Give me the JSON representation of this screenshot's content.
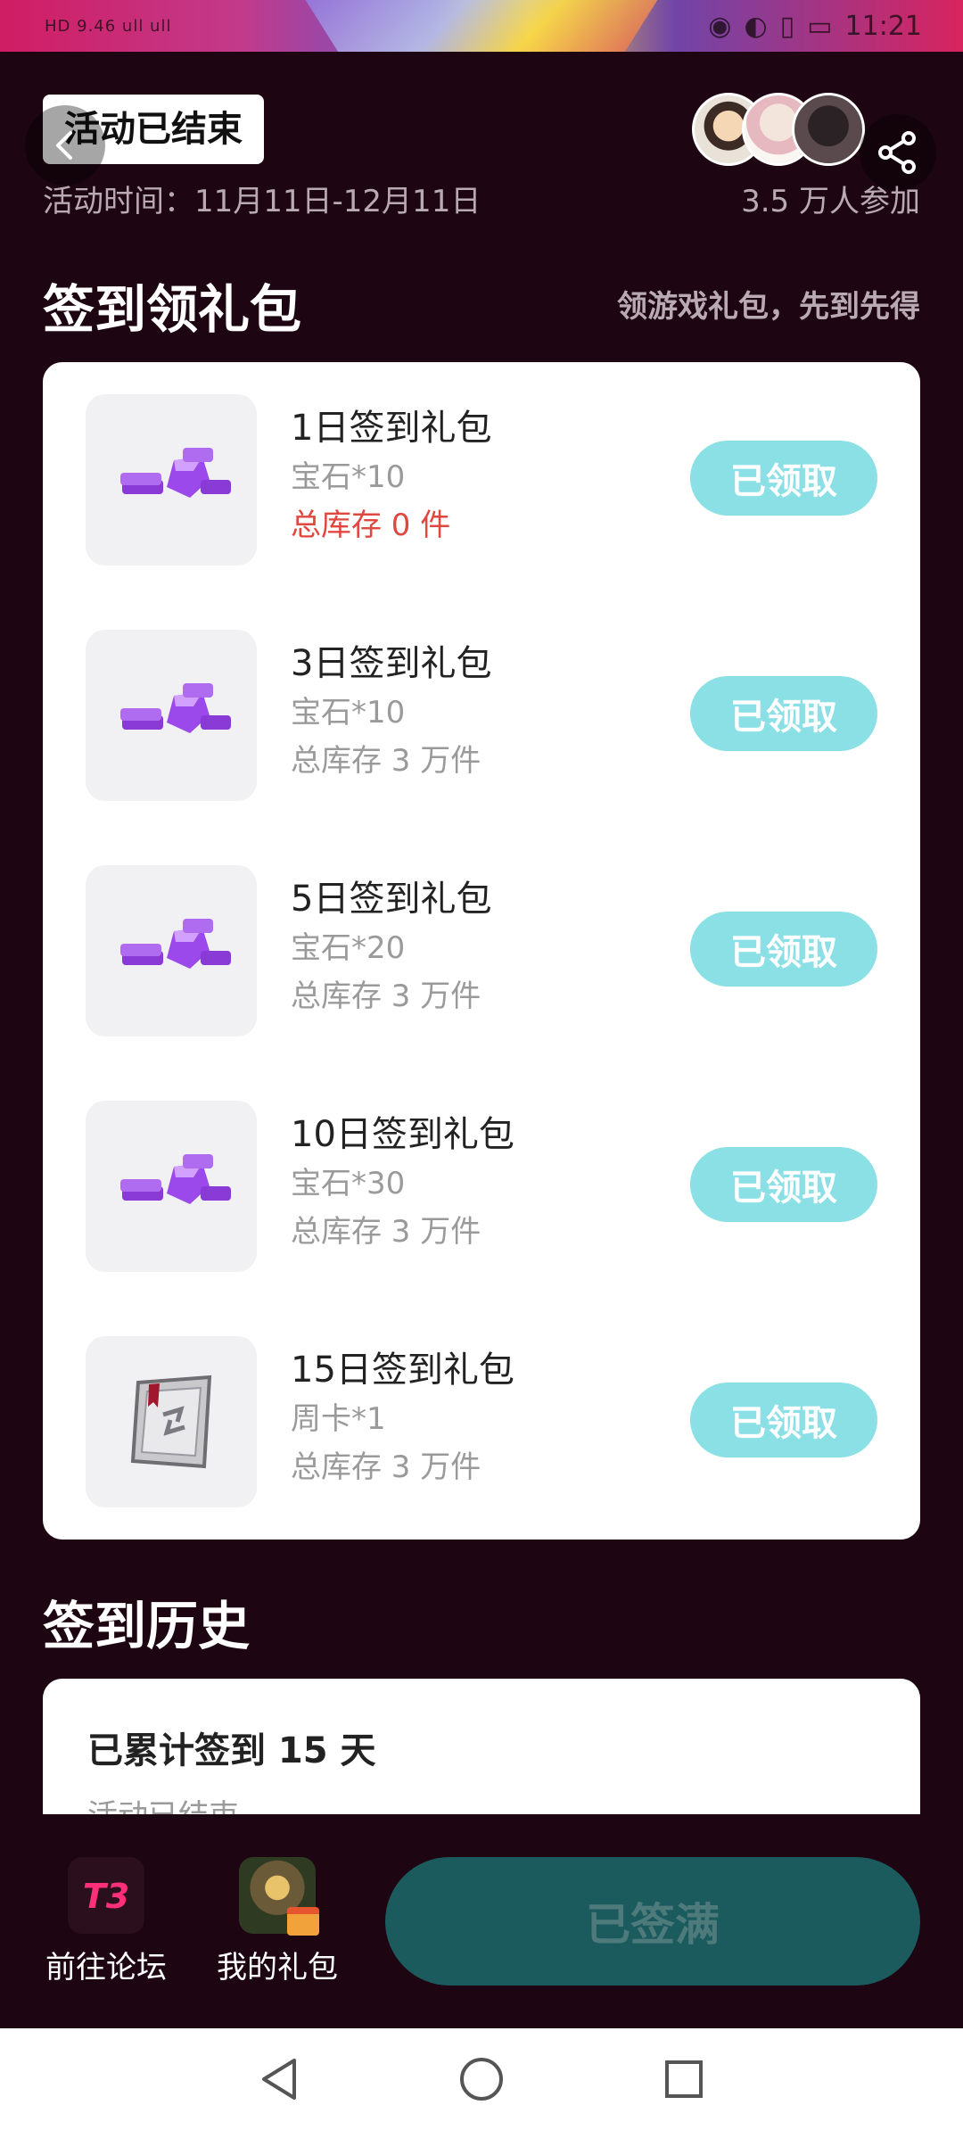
{
  "status_bar": {
    "left_text": "HD 9.46 ull ull",
    "time": "11:21"
  },
  "header": {
    "ended_badge": "活动已结束",
    "activity_time": "活动时间：11月11日-12月11日",
    "participants": "3.5 万人参加"
  },
  "signin_section": {
    "title": "签到领礼包",
    "subtitle": "领游戏礼包，先到先得"
  },
  "gifts": [
    {
      "title": "1日签到礼包",
      "detail": "宝石*10",
      "stock": "总库存 0 件",
      "button": "已领取",
      "icon": "gem-icon"
    },
    {
      "title": "3日签到礼包",
      "detail": "宝石*10",
      "stock": "总库存 3 万件",
      "button": "已领取",
      "icon": "gem-icon"
    },
    {
      "title": "5日签到礼包",
      "detail": "宝石*20",
      "stock": "总库存 3 万件",
      "button": "已领取",
      "icon": "gem-icon"
    },
    {
      "title": "10日签到礼包",
      "detail": "宝石*30",
      "stock": "总库存 3 万件",
      "button": "已领取",
      "icon": "gem-icon"
    },
    {
      "title": "15日签到礼包",
      "detail": "周卡*1",
      "stock": "总库存 3 万件",
      "button": "已领取",
      "icon": "weekly-card-icon"
    }
  ],
  "history": {
    "title": "签到历史",
    "total": "已累计签到 15 天",
    "status": "活动已结束"
  },
  "action_bar": {
    "forum_label": "前往论坛",
    "forum_logo": "T3",
    "my_gifts_label": "我的礼包",
    "main_button": "已签满"
  },
  "colors": {
    "background": "#1d0512",
    "claim_button": "#8be0e6",
    "main_button": "#1b5b5e",
    "stock_empty": "#e0473e"
  }
}
